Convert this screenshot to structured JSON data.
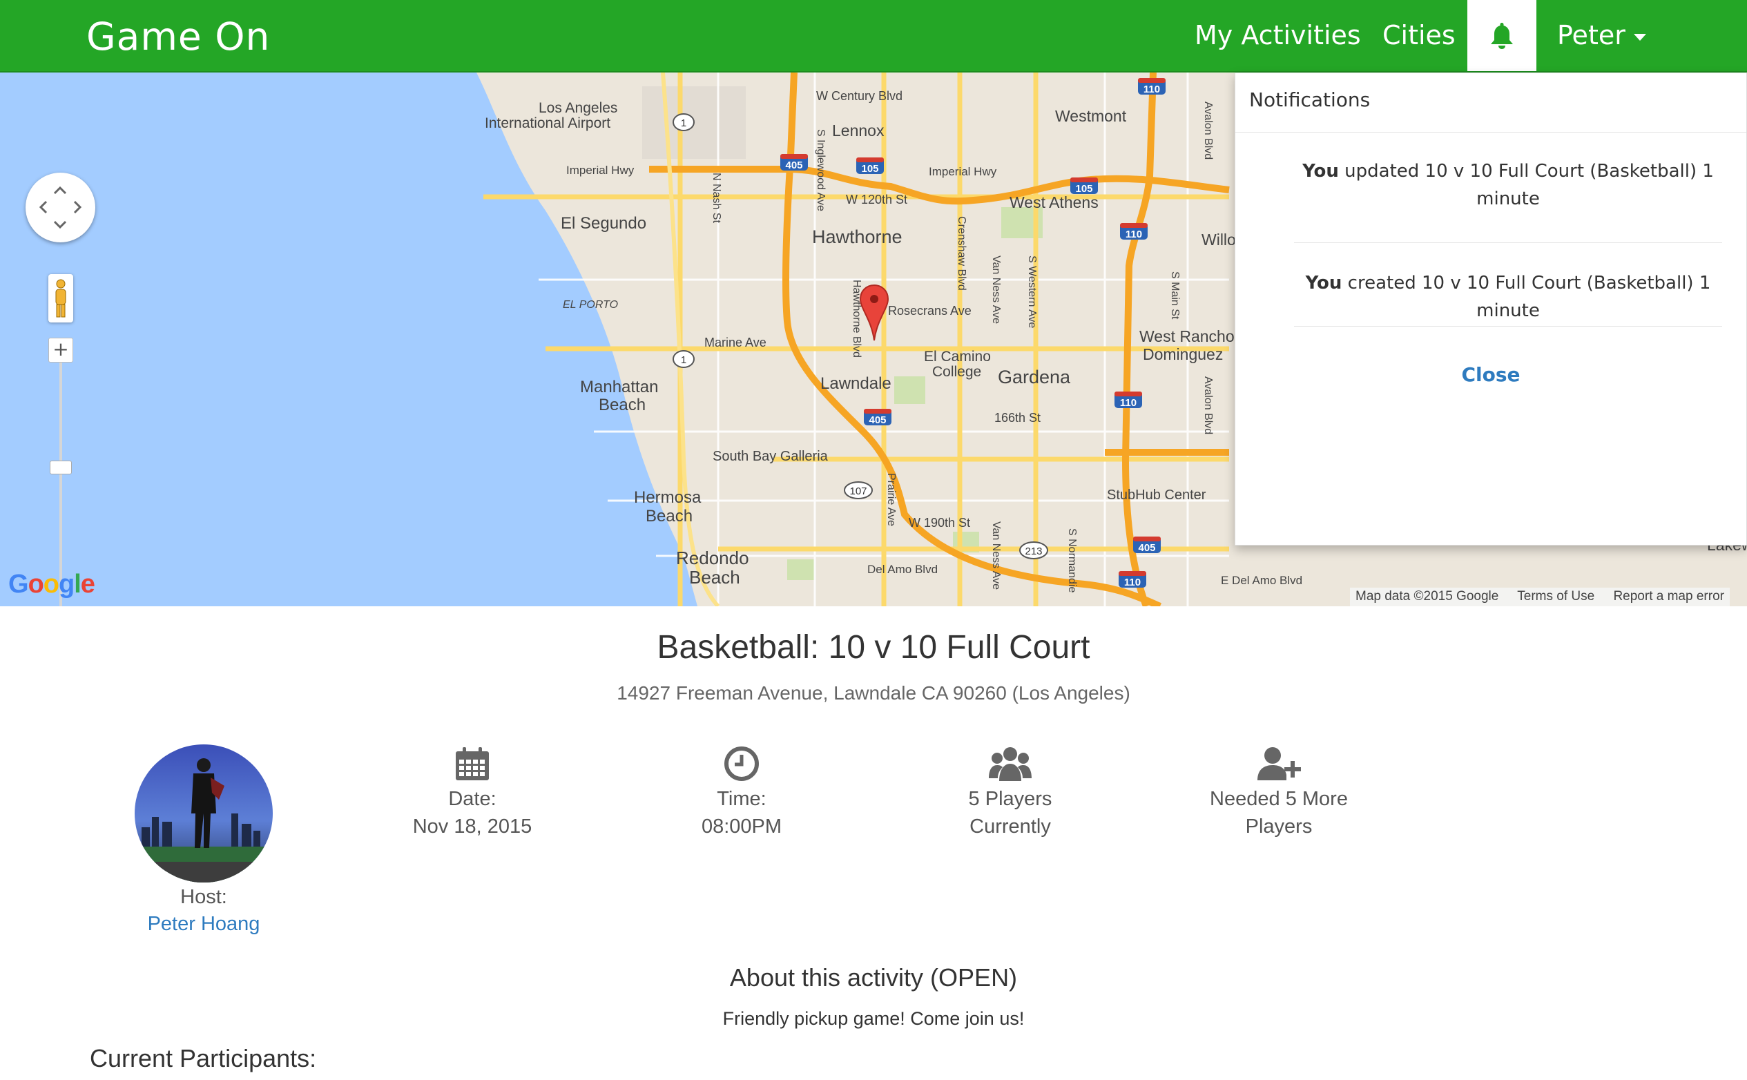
{
  "navbar": {
    "brand": "Game On",
    "my_activities": "My Activities",
    "cities": "Cities",
    "bell_icon": "bell-icon",
    "user": "Peter",
    "color": "#24a626"
  },
  "map": {
    "labels": {
      "lax": "Los Angeles",
      "lax2": "International Airport",
      "century": "W Century Blvd",
      "westmont": "Westmont",
      "lennox": "Lennox",
      "imperial1": "Imperial Hwy",
      "imperial2": "Imperial Hwy",
      "w120": "W 120th St",
      "westathens": "West Athens",
      "elsegundo": "El Segundo",
      "hawthorne": "Hawthorne",
      "elporto": "EL PORTO",
      "rosecrans": "Rosecrans Ave",
      "marine": "Marine Ave",
      "westrancho": "West Rancho",
      "dominguez": "Dominguez",
      "elcamino": "El Camino",
      "college": "College",
      "gardena": "Gardena",
      "manhattan": "Manhattan",
      "beach1": "Beach",
      "lawndale": "Lawndale",
      "s166": "166th St",
      "galleria": "South Bay Galleria",
      "hermosa": "Hermosa",
      "beach2": "Beach",
      "stubhub": "StubHub Center",
      "w190": "W 190th St",
      "redondo": "Redondo",
      "beach3": "Beach",
      "delamo1": "Del Amo Blvd",
      "delamo2": "E Del Amo Blvd",
      "willo": "Willo",
      "lakew": "Lakew",
      "nash": "N Nash St",
      "inglewood": "S Inglewood Ave",
      "hawthorneblvd": "Hawthorne Blvd",
      "crenshaw": "Crenshaw Blvd",
      "vanness1": "Van Ness Ave",
      "western": "S Western Ave",
      "main": "S Main St",
      "avalon1": "Avalon Blvd",
      "avalon2": "Avalon Blvd",
      "prairie": "Prairie Ave",
      "vanness2": "Van Ness Ave",
      "normandie": "S Normandie"
    },
    "shields": {
      "s405a": "405",
      "s105a": "105",
      "s105b": "105",
      "s110a": "110",
      "s110b": "110",
      "s110c": "110",
      "s405b": "405",
      "s405c": "405",
      "s110d": "110",
      "s1a": "1",
      "s1b": "1",
      "s107": "107",
      "s213": "213"
    },
    "google": "Google",
    "footer": {
      "data": "Map data ©2015 Google",
      "terms": "Terms of Use",
      "report": "Report a map error"
    }
  },
  "notifications": {
    "title": "Notifications",
    "items": [
      {
        "actor": "You",
        "text": " updated 10 v 10 Full Court (Basketball) 1 minute"
      },
      {
        "actor": "You",
        "text": " created 10 v 10 Full Court (Basketball) 1 minute"
      }
    ],
    "close": "Close"
  },
  "activity": {
    "title": "Basketball: 10 v 10 Full Court",
    "address": "14927 Freeman Avenue, Lawndale CA 90260 (Los Angeles)",
    "host_label": "Host:",
    "host_name": "Peter Hoang",
    "stats": {
      "date": {
        "icon": "calendar-icon",
        "label": "Date:",
        "value": "Nov 18, 2015"
      },
      "time": {
        "icon": "clock-icon",
        "label": "Time:",
        "value": "08:00PM"
      },
      "players": {
        "icon": "group-icon",
        "label": "5 Players",
        "value": "Currently"
      },
      "needed": {
        "icon": "add-user-icon",
        "label": "Needed 5 More",
        "value": "Players"
      }
    },
    "about_title": "About this activity (OPEN)",
    "about_text": "Friendly pickup game! Come join us!",
    "participants_title": "Current Participants:"
  }
}
